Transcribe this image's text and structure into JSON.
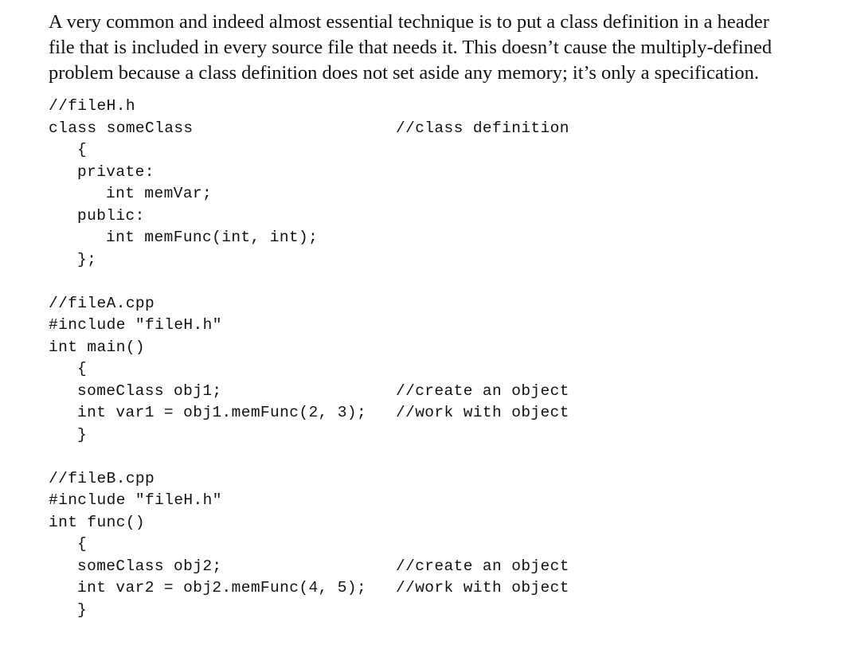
{
  "paragraph": {
    "lines": [
      "A very common and indeed almost essential technique is to put a class definition in a header",
      "file that is included in every source file that needs it. This doesn’t cause the multiply-defined",
      "problem because a class definition does not set aside any memory; it’s only a specification."
    ]
  },
  "code": {
    "fileH": {
      "header": "//fileH.h",
      "class_decl": "class someClass",
      "class_comment": "//class definition",
      "open_brace": "{",
      "private_label": "private:",
      "member_var": "int memVar;",
      "public_label": "public:",
      "member_func": "int memFunc(int, int);",
      "close_brace": "};"
    },
    "fileA": {
      "header": "//fileA.cpp",
      "include": "#include \"fileH.h\"",
      "func_decl": "int main()",
      "open_brace": "{",
      "stmt1": "someClass obj1;",
      "stmt1_comment": "//create an object",
      "stmt2": "int var1 = obj1.memFunc(2, 3);",
      "stmt2_comment": "//work with object",
      "close_brace": "}"
    },
    "fileB": {
      "header": "//fileB.cpp",
      "include": "#include \"fileH.h\"",
      "func_decl": "int func()",
      "open_brace": "{",
      "stmt1": "someClass obj2;",
      "stmt1_comment": "//create an object",
      "stmt2": "int var2 = obj2.memFunc(4, 5);",
      "stmt2_comment": "//work with object",
      "close_brace": "}"
    }
  }
}
